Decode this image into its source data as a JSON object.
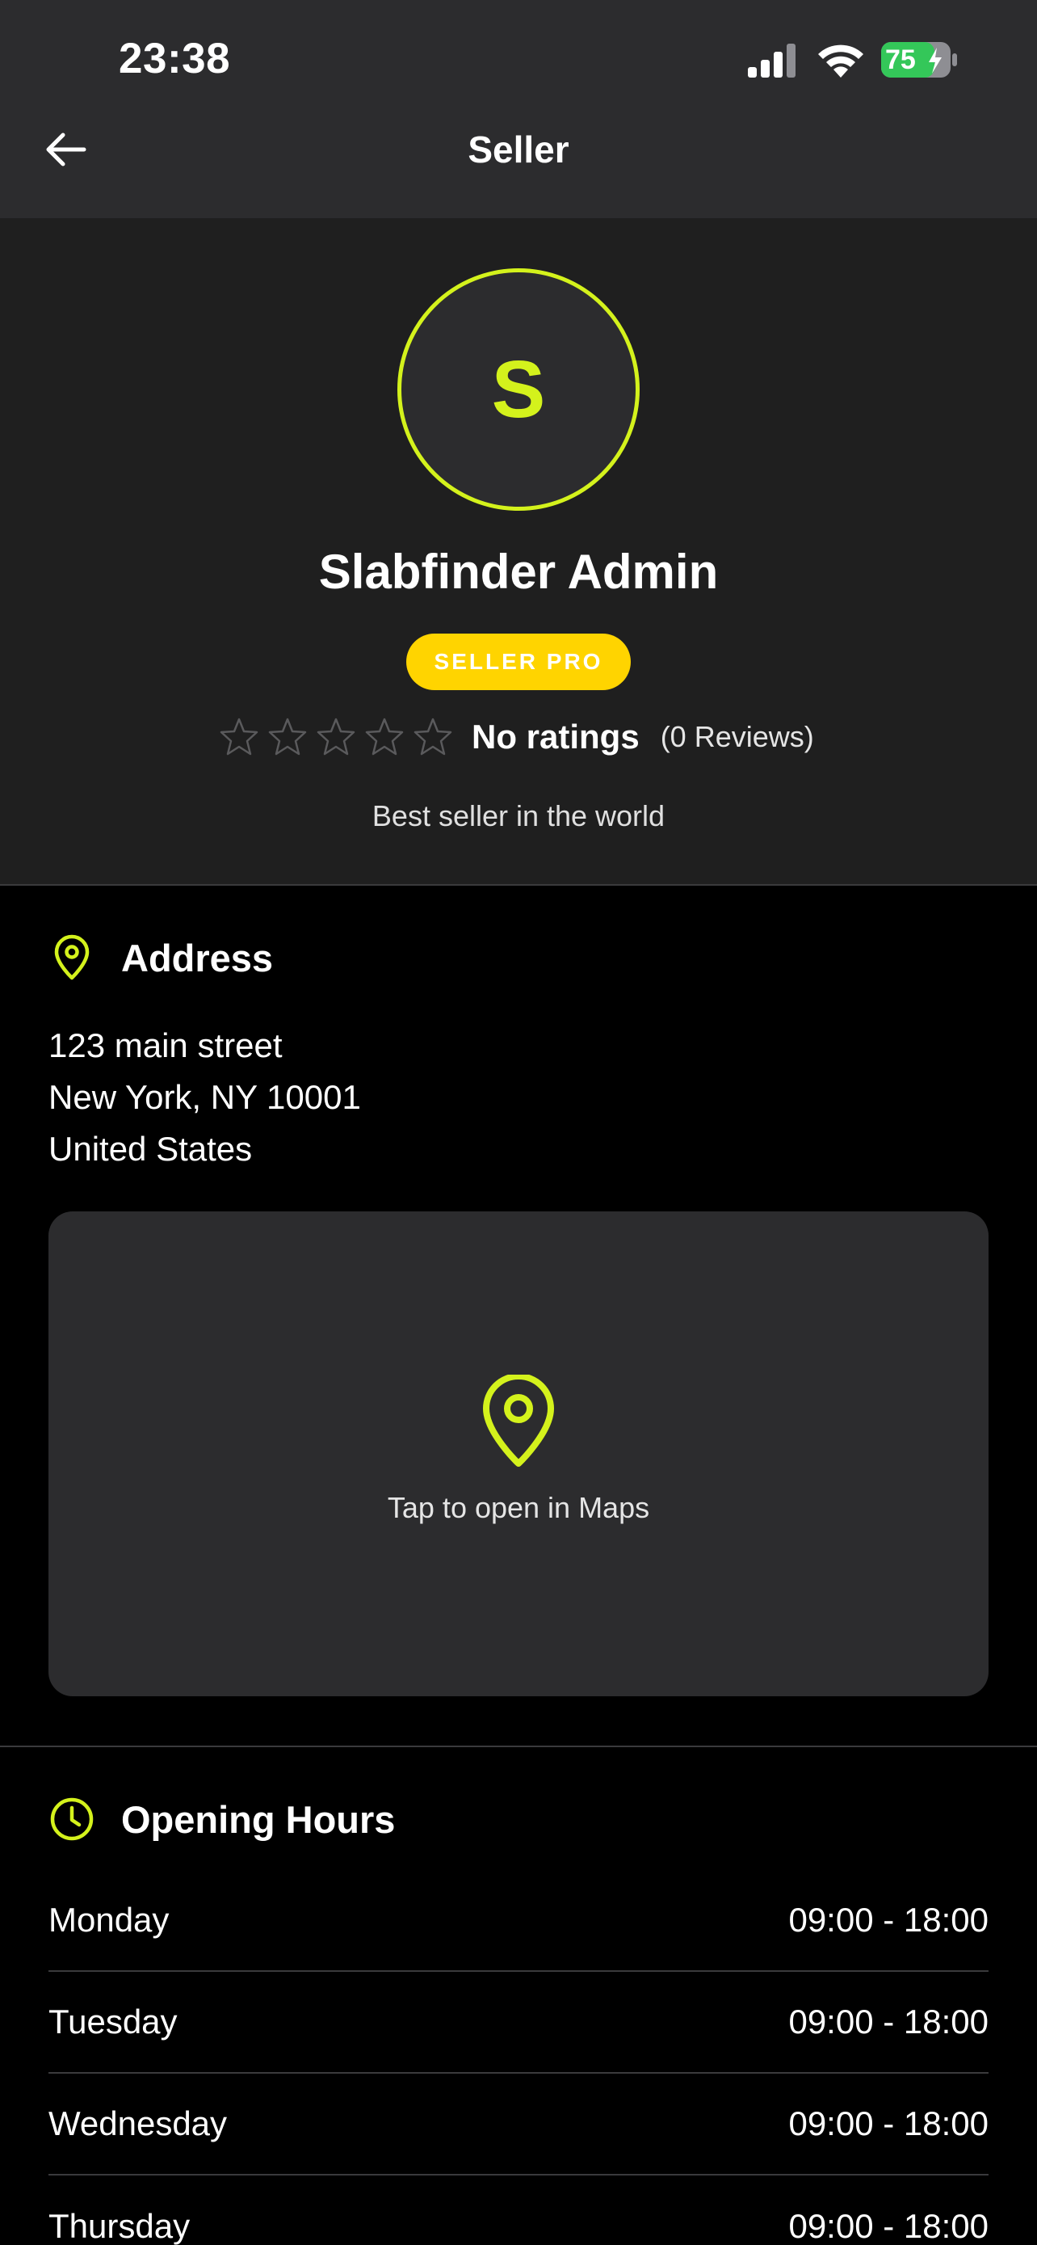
{
  "status_bar": {
    "time": "23:38",
    "battery_level": "75"
  },
  "header": {
    "title": "Seller"
  },
  "seller": {
    "initial": "S",
    "name": "Slabfinder Admin",
    "badge": "SELLER PRO",
    "stars_filled": 0,
    "stars_total": 5,
    "rating_text": "No ratings",
    "reviews_text": "(0 Reviews)",
    "bio": "Best seller in the world"
  },
  "address": {
    "title": "Address",
    "lines": [
      "123 main street",
      "New York, NY 10001",
      "United States"
    ],
    "map_label": "Tap to open in Maps"
  },
  "opening_hours": {
    "title": "Opening Hours",
    "days": [
      {
        "day": "Monday",
        "hours": "09:00 - 18:00"
      },
      {
        "day": "Tuesday",
        "hours": "09:00 - 18:00"
      },
      {
        "day": "Wednesday",
        "hours": "09:00 - 18:00"
      },
      {
        "day": "Thursday",
        "hours": "09:00 - 18:00"
      }
    ]
  },
  "colors": {
    "accent": "#d4f21c",
    "badge": "#ffd400",
    "battery": "#34c759",
    "background": "#000000",
    "surface": "#2c2c2e"
  }
}
